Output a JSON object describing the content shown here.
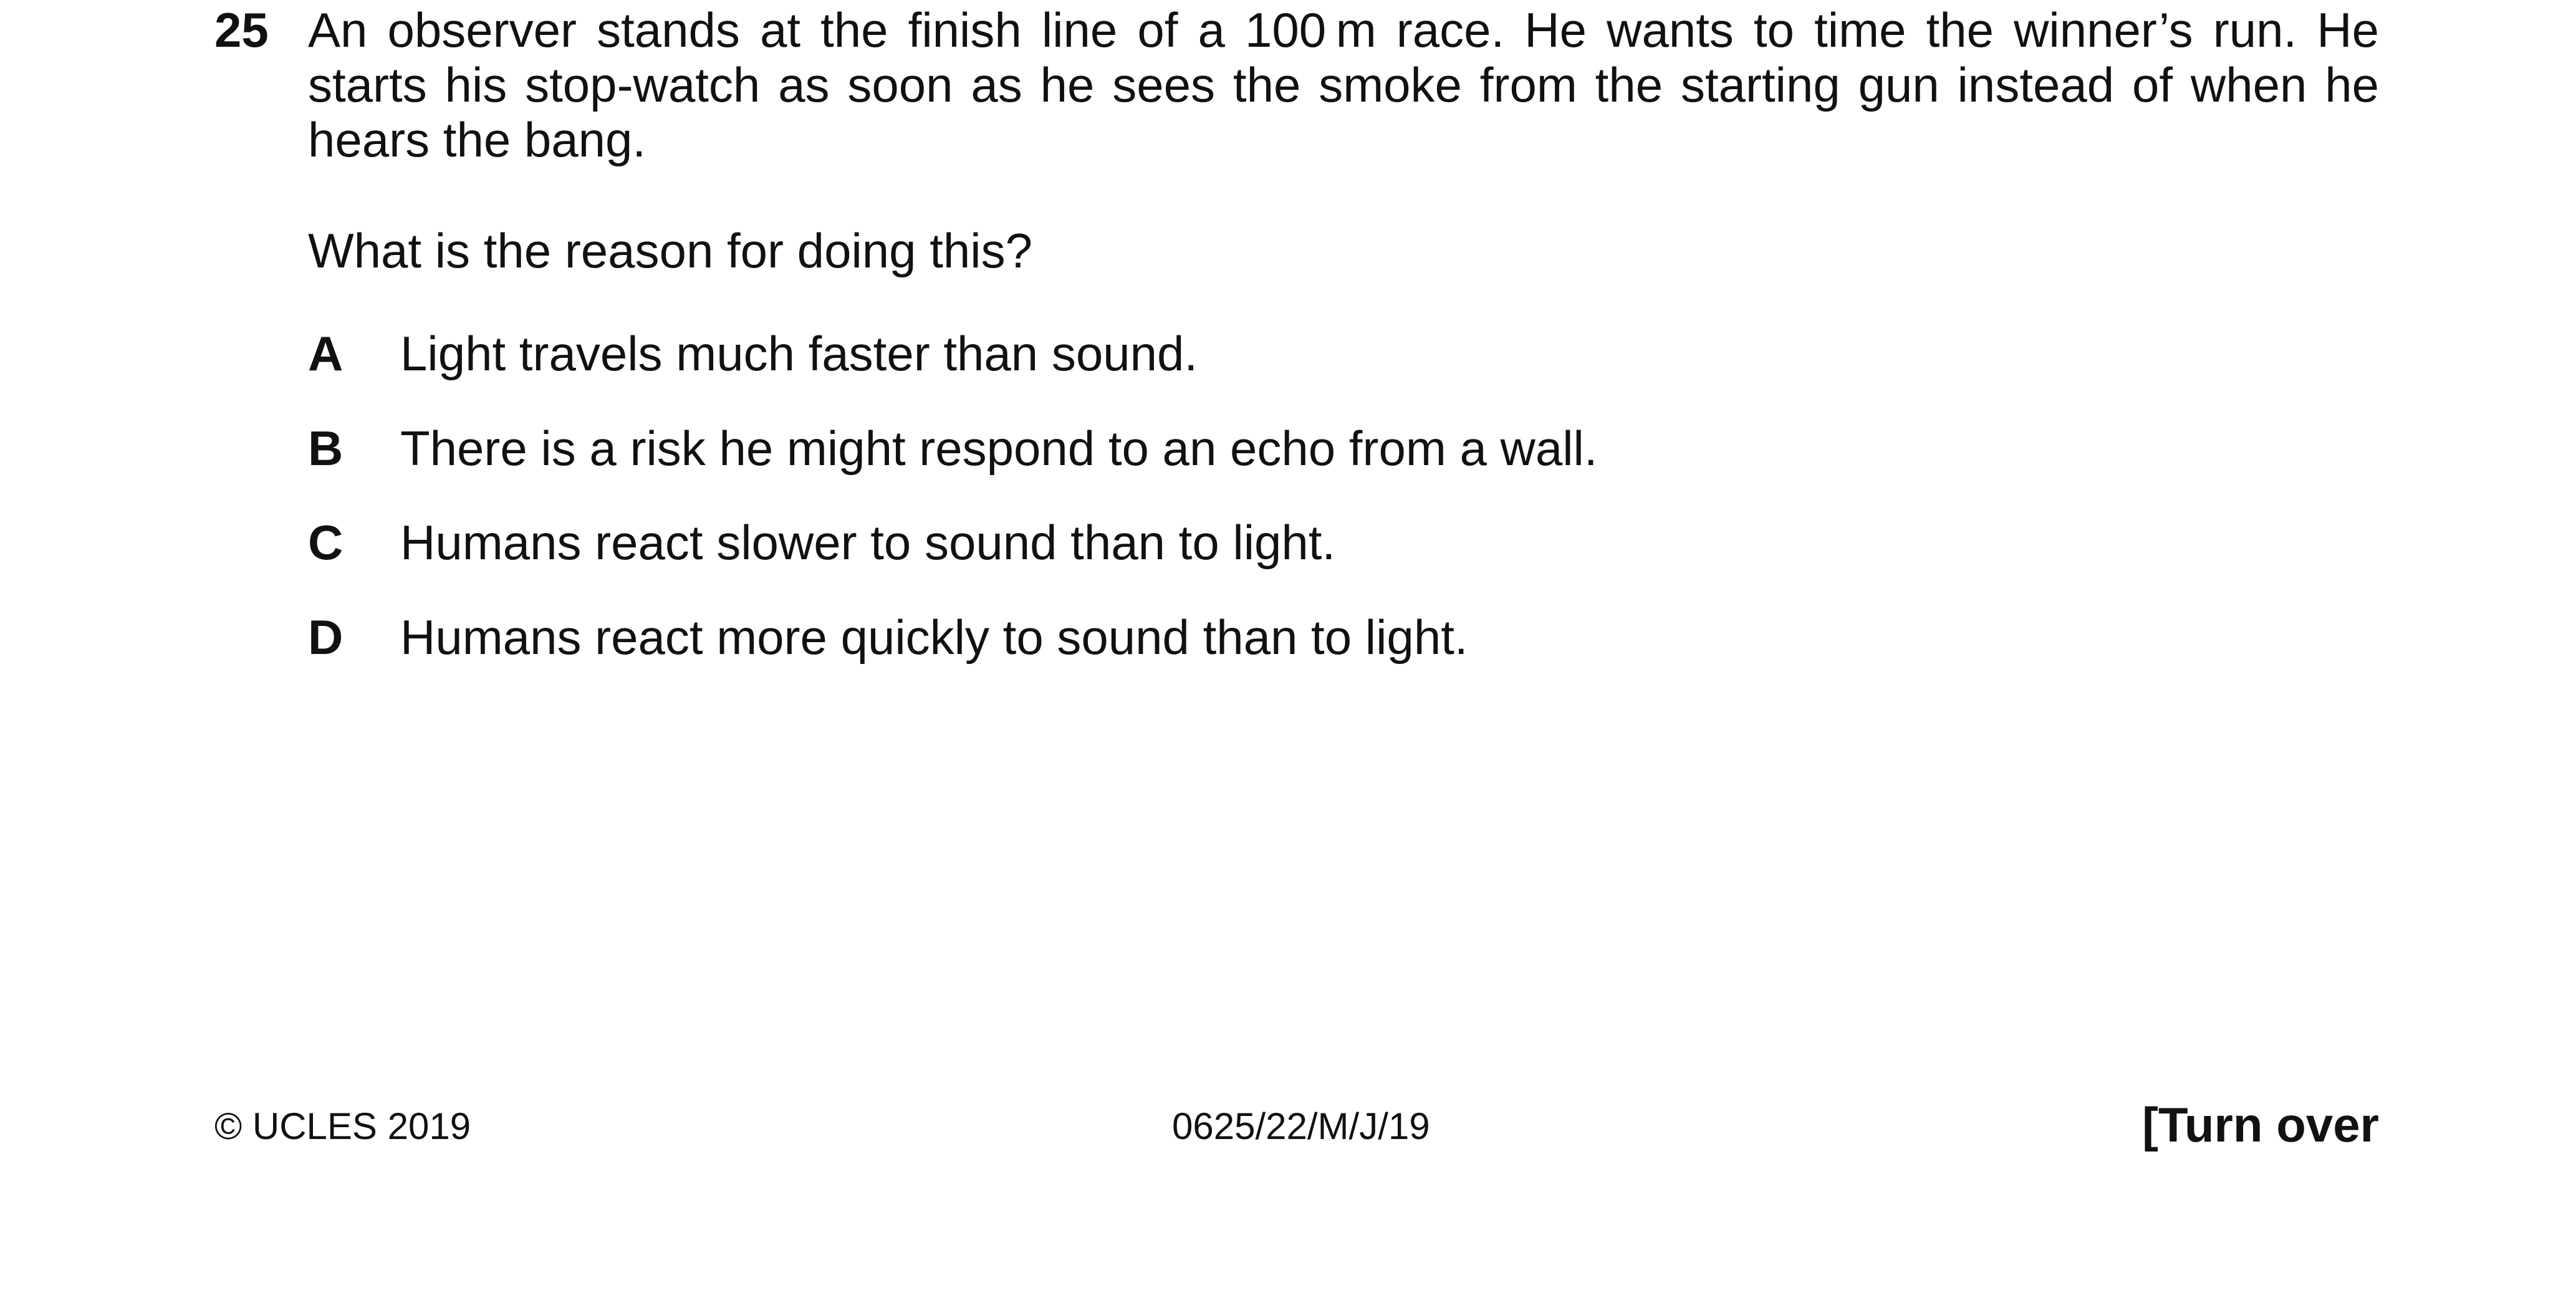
{
  "question": {
    "number": "25",
    "stem": "An observer stands at the finish line of a 100 m race. He wants to time the winner’s run. He starts his stop-watch as soon as he sees the smoke from the starting gun instead of when he hears the bang.",
    "prompt": "What is the reason for doing this?",
    "options": [
      {
        "letter": "A",
        "text": "Light travels much faster than sound."
      },
      {
        "letter": "B",
        "text": "There is a risk he might respond to an echo from a wall."
      },
      {
        "letter": "C",
        "text": "Humans react slower to sound than to light."
      },
      {
        "letter": "D",
        "text": "Humans react more quickly to sound than to light."
      }
    ]
  },
  "footer": {
    "copyright": "© UCLES 2019",
    "paper_code": "0625/22/M/J/19",
    "turn_over": "[Turn over"
  }
}
